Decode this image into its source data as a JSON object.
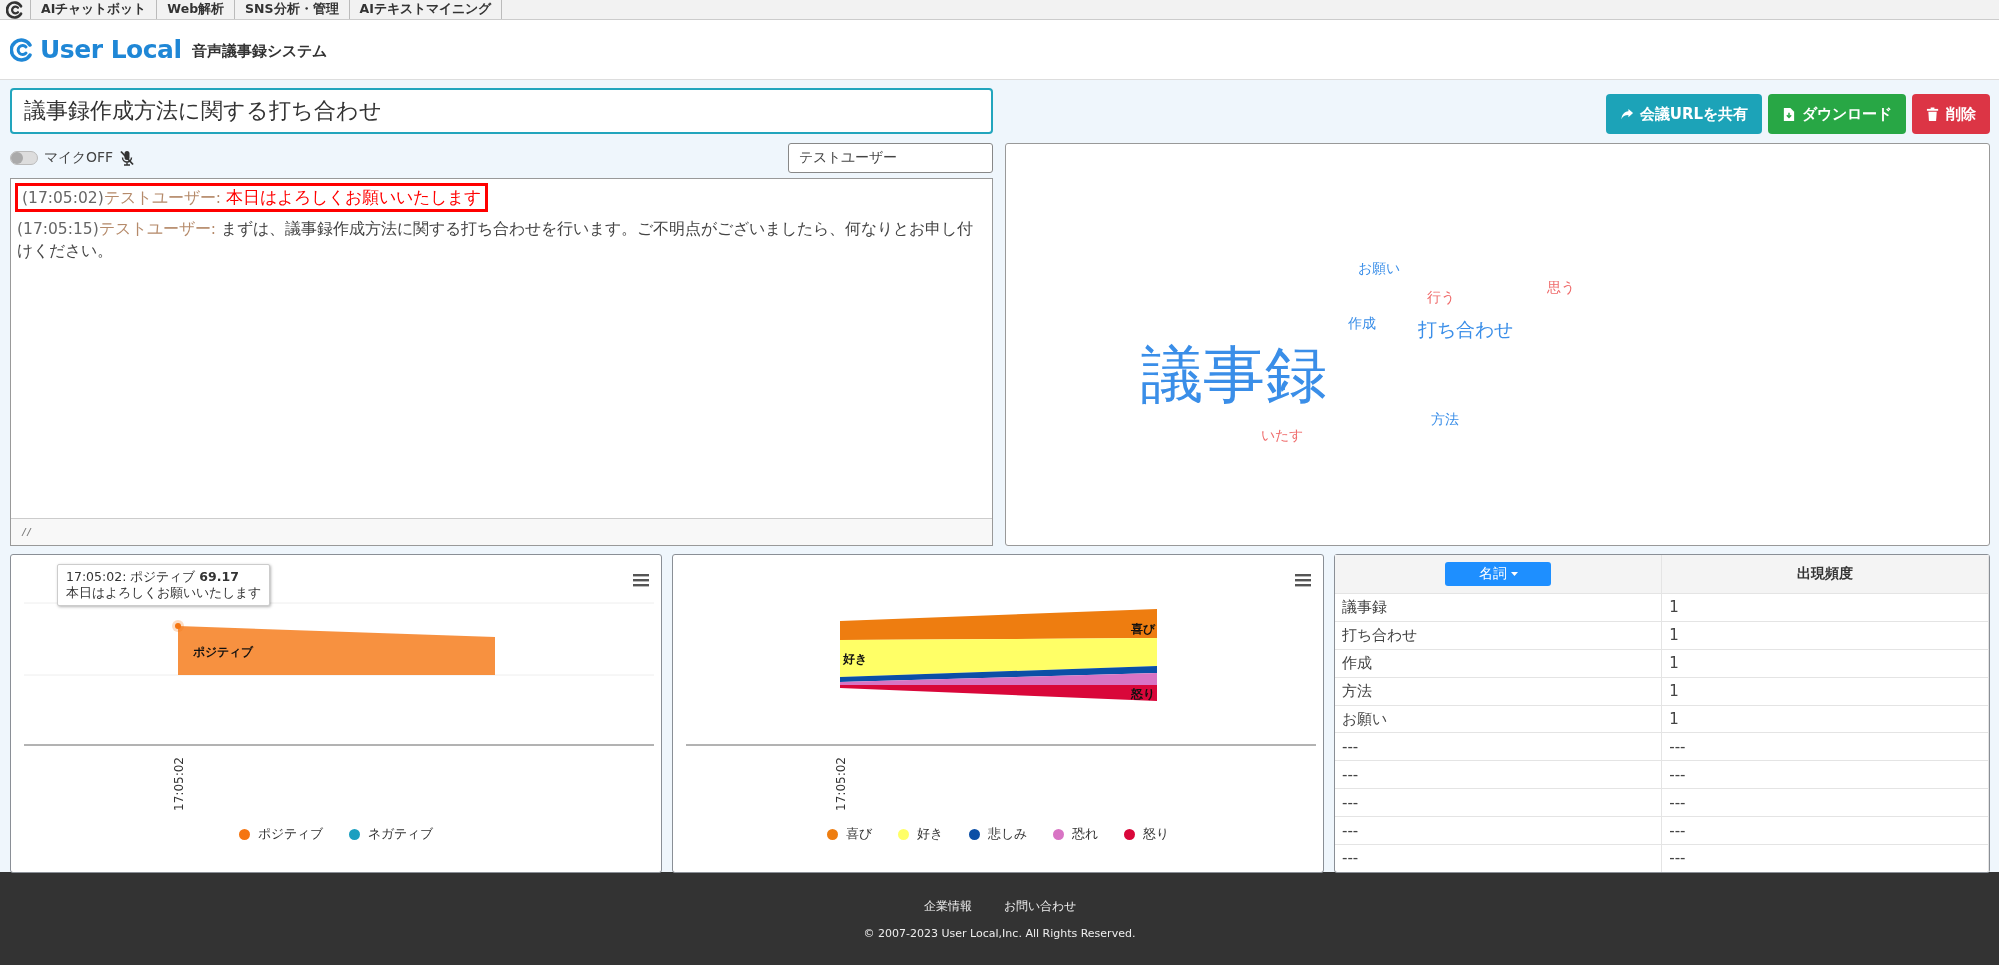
{
  "top_nav": {
    "items": [
      {
        "label": "AIチャットボット"
      },
      {
        "label": "Web解析"
      },
      {
        "label": "SNS分析・管理"
      },
      {
        "label": "AIテキストマイニング"
      }
    ]
  },
  "header": {
    "logo_text": "User Local",
    "product": "音声議事録システム"
  },
  "meeting_title": {
    "value": "議事録作成方法に関する打ち合わせ"
  },
  "actions": [
    {
      "label": "会議URLを共有",
      "kind": "share"
    },
    {
      "label": "ダウンロード",
      "kind": "download"
    },
    {
      "label": "削除",
      "kind": "delete"
    }
  ],
  "mic": {
    "on": false,
    "label": "マイクOFF"
  },
  "speaker_select": {
    "value": "テストユーザー"
  },
  "transcript": [
    {
      "time": "(17:05:02)",
      "speaker": "テストユーザー:",
      "text": "本日はよろしくお願いいたします",
      "highlighted": true
    },
    {
      "time": "(17:05:15)",
      "speaker": "テストユーザー:",
      "text": "まずは、議事録作成方法に関する打ち合わせを行います。ご不明点がございましたら、何なりとお申し付けください。",
      "highlighted": false
    }
  ],
  "word_cloud": [
    {
      "word": "お願い",
      "color": "#3a8ee8",
      "kind": "small"
    },
    {
      "word": "行う",
      "color": "#ef6b6b",
      "kind": "small"
    },
    {
      "word": "思う",
      "color": "#ef6b6b",
      "kind": "small"
    },
    {
      "word": "作成",
      "color": "#3a8ee8",
      "kind": "small"
    },
    {
      "word": "打ち合わせ",
      "color": "#3a8ee8",
      "kind": "medium"
    },
    {
      "word": "議事録",
      "color": "#3a8ee8",
      "kind": "large"
    },
    {
      "word": "方法",
      "color": "#3a8ee8",
      "kind": "small"
    },
    {
      "word": "いたす",
      "color": "#ef6b6b",
      "kind": "small"
    }
  ],
  "sentiment_chart": {
    "tooltip": {
      "title": "17:05:02: ポジティブ **69.17**",
      "text": "本日はよろしくお願いいたします"
    },
    "series_label": "ポジティブ",
    "x_label": "17:05:02",
    "legend": [
      {
        "label": "ポジティブ",
        "color": "#f57510"
      },
      {
        "label": "ネガティブ",
        "color": "#1a9fc0"
      }
    ]
  },
  "emotion_chart": {
    "band_labels": [
      "喜び",
      "好き",
      "怒り"
    ],
    "x_label": "17:05:02",
    "legend": [
      {
        "label": "喜び",
        "color": "#ee7d10"
      },
      {
        "label": "好き",
        "color": "#ffff66"
      },
      {
        "label": "悲しみ",
        "color": "#0b4fa6"
      },
      {
        "label": "恐れ",
        "color": "#d874c4"
      },
      {
        "label": "怒り",
        "color": "#d9073a"
      }
    ]
  },
  "word_table": {
    "pos_button": "名詞",
    "column_2": "出現頻度",
    "rows": [
      [
        "議事録",
        "1"
      ],
      [
        "打ち合わせ",
        "1"
      ],
      [
        "作成",
        "1"
      ],
      [
        "方法",
        "1"
      ],
      [
        "お願い",
        "1"
      ],
      [
        "---",
        "---"
      ],
      [
        "---",
        "---"
      ],
      [
        "---",
        "---"
      ],
      [
        "---",
        "---"
      ],
      [
        "---",
        "---"
      ]
    ]
  },
  "footer": {
    "links": [
      "企業情報",
      "お問い合わせ"
    ],
    "copyright": "© 2007-2023 User Local,Inc. All Rights Reserved."
  }
}
